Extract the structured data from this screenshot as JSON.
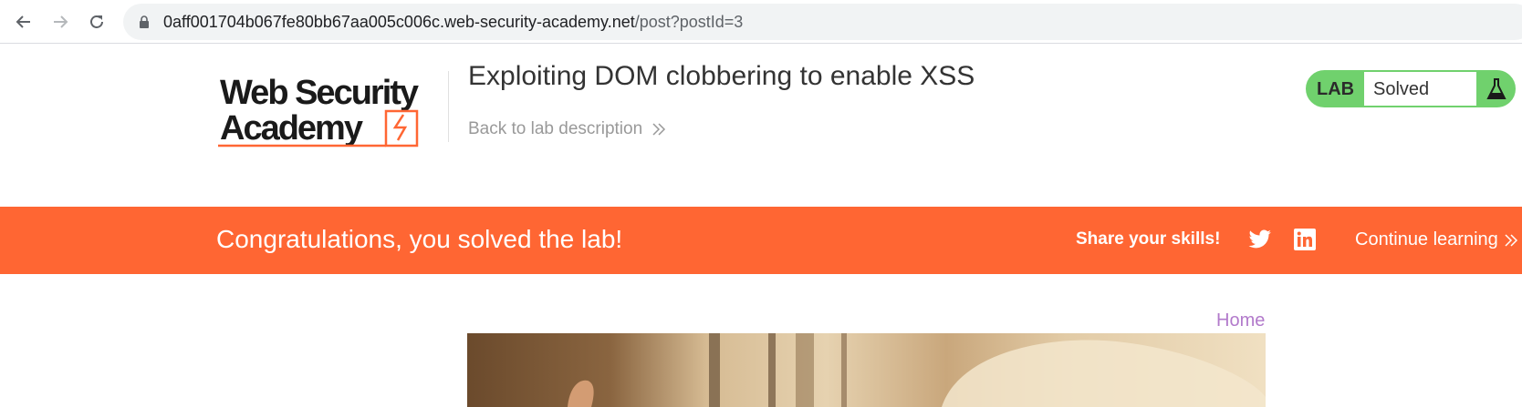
{
  "browser": {
    "url_host": "0aff001704b067fe80bb67aa005c006c.web-security-academy.net",
    "url_path": "/post?postId=3",
    "back_icon": "arrow-left-icon",
    "forward_icon": "arrow-right-icon",
    "reload_icon": "reload-icon",
    "lock_icon": "lock-icon"
  },
  "header": {
    "logo_text": "Web Security Academy",
    "lab_title": "Exploiting DOM clobbering to enable XSS",
    "back_link": "Back to lab description",
    "lab_badge": {
      "label": "LAB",
      "status": "Solved",
      "icon": "flask-icon",
      "color": "#70d16d"
    }
  },
  "banner": {
    "message": "Congratulations, you solved the lab!",
    "share_label": "Share your skills!",
    "twitter_icon": "twitter-icon",
    "linkedin_icon": "linkedin-icon",
    "continue_label": "Continue learning",
    "color": "#ff6633"
  },
  "content": {
    "home_link": "Home",
    "home_color": "#b27acb"
  }
}
